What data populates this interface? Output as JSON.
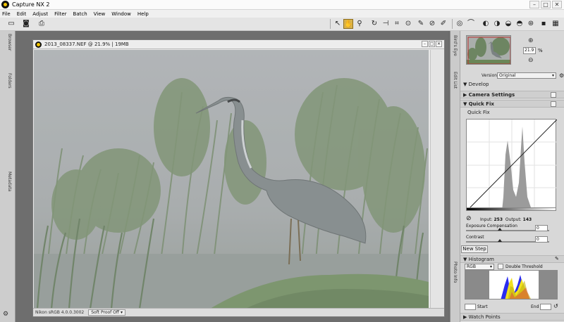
{
  "app": {
    "title": "Capture NX 2",
    "window_buttons": [
      "–",
      "□",
      "✕"
    ]
  },
  "menu": [
    "File",
    "Edit",
    "Adjust",
    "Filter",
    "Batch",
    "View",
    "Window",
    "Help"
  ],
  "left_tabs": [
    "Browser",
    "Folders",
    "Metadata"
  ],
  "document": {
    "title": "2013_08337.NEF @ 21.9% | 19MB",
    "profile": "Nikon sRGB 4.0.0.3002",
    "softproof": "Soft Proof Off"
  },
  "right_tabs": [
    "Bird's Eye",
    "Edit List",
    "Photo Info"
  ],
  "navigator": {
    "zoom_value": "21.9",
    "zoom_unit": "%"
  },
  "edit_list": {
    "version_label": "Version",
    "version_value": "Original",
    "develop": "Develop",
    "camera_settings": "Camera Settings",
    "quick_fix": "Quick Fix",
    "quick_fix_sub": "Quick Fix",
    "input_label": "Input:",
    "input_value": "253",
    "output_label": "Output:",
    "output_value": "143",
    "exposure_label": "Exposure Compensation",
    "exposure_value": "0",
    "contrast_label": "Contrast",
    "contrast_value": "0",
    "new_step": "New Step"
  },
  "histogram": {
    "title": "Histogram",
    "channel": "RGB",
    "double_threshold": "Double Threshold",
    "start_label": "Start",
    "end_label": "End",
    "watch_points": "Watch Points"
  },
  "colors": {
    "accent": "#d9b24a"
  }
}
